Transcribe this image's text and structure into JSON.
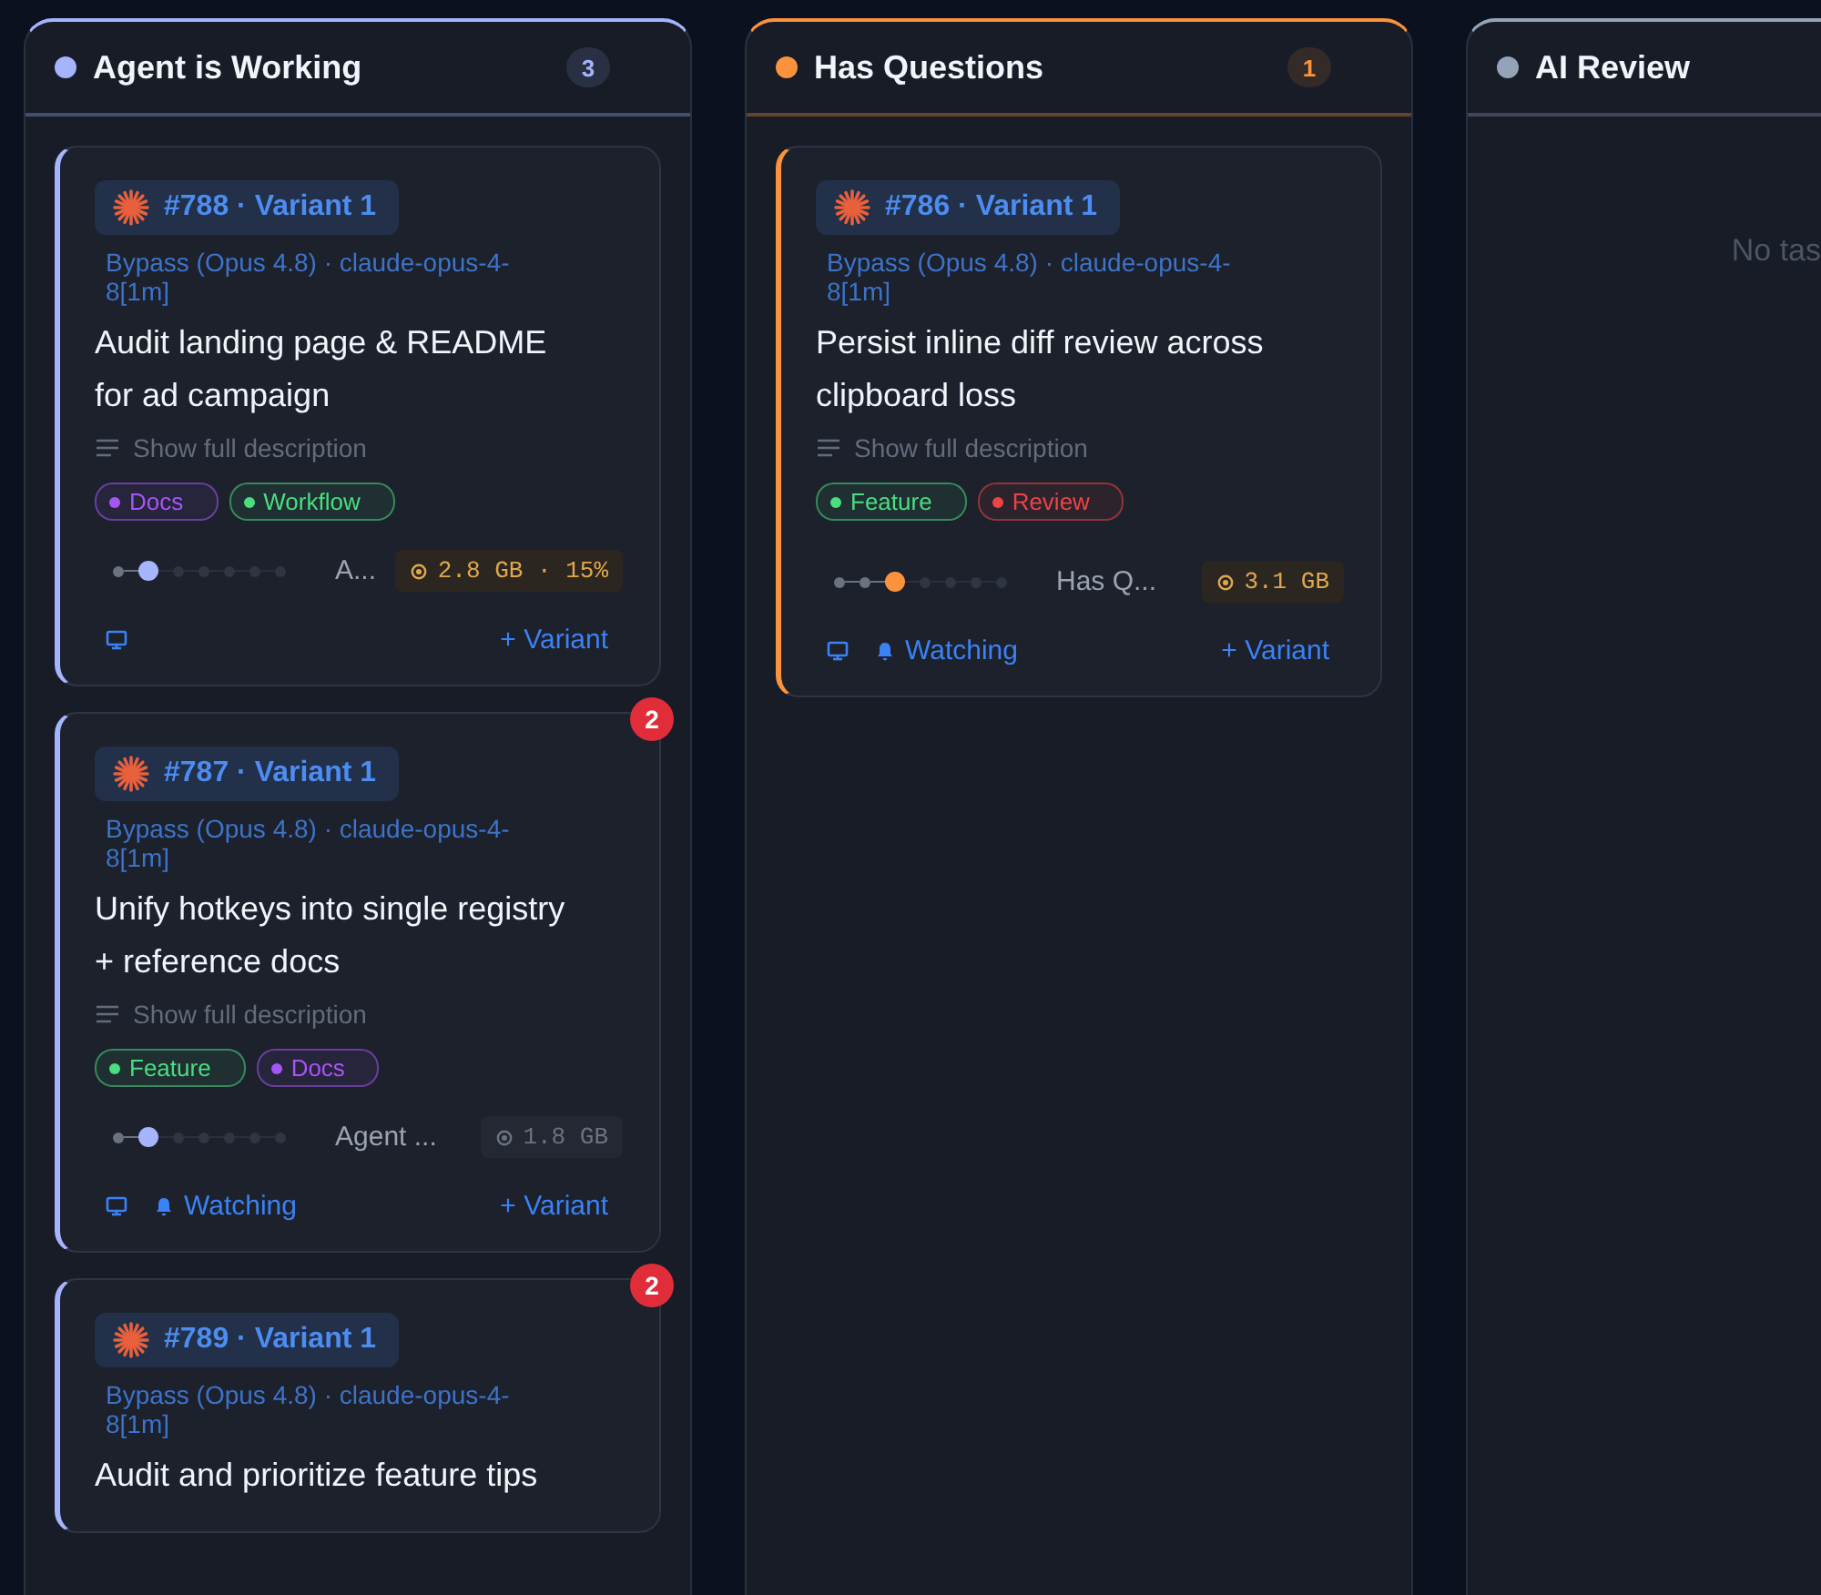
{
  "columns": [
    {
      "title": "Agent is Working",
      "color": "#a5b4fc",
      "count": "3",
      "cards": [
        {
          "ref": "#788 · Variant 1",
          "model": "Bypass (Opus 4.8) · claude-opus-4-8[1m]",
          "title": "Audit landing page & README for ad campaign",
          "toggle": "Show full description",
          "tags": [
            {
              "label": "Docs",
              "color": "#a855f7"
            },
            {
              "label": "Workflow",
              "color": "#4ade80"
            }
          ],
          "steps": [
            {
              "kind": "done"
            },
            {
              "kind": "current"
            },
            {
              "kind": "todo"
            },
            {
              "kind": "todo"
            },
            {
              "kind": "todo"
            },
            {
              "kind": "todo"
            },
            {
              "kind": "todo"
            }
          ],
          "status": "A...",
          "resource": {
            "text": "2.8 GB · 15%",
            "highlighted": true
          },
          "variant_label": "+ Variant"
        },
        {
          "ref": "#787 · Variant 1",
          "model": "Bypass (Opus 4.8) · claude-opus-4-8[1m]",
          "title": "Unify hotkeys into single registry + reference docs",
          "toggle": "Show full description",
          "tags": [
            {
              "label": "Feature",
              "color": "#4ade80"
            },
            {
              "label": "Docs",
              "color": "#a855f7"
            }
          ],
          "steps": [
            {
              "kind": "done"
            },
            {
              "kind": "current"
            },
            {
              "kind": "todo"
            },
            {
              "kind": "todo"
            },
            {
              "kind": "todo"
            },
            {
              "kind": "todo"
            },
            {
              "kind": "todo"
            }
          ],
          "status": "Agent ...",
          "resource": {
            "text": "1.8 GB",
            "highlighted": false
          },
          "watch_label": "Watching",
          "variant_label": "+ Variant",
          "badge": "2"
        },
        {
          "ref": "#789 · Variant 1",
          "model": "Bypass (Opus 4.8) · claude-opus-4-8[1m]",
          "title": "Audit and prioritize feature tips",
          "badge": "2"
        }
      ]
    },
    {
      "title": "Has Questions",
      "color": "#fb923c",
      "count": "1",
      "cards": [
        {
          "ref": "#786 · Variant 1",
          "model": "Bypass (Opus 4.8) · claude-opus-4-8[1m]",
          "title": "Persist inline diff review across clipboard loss",
          "toggle": "Show full description",
          "tags": [
            {
              "label": "Feature",
              "color": "#4ade80"
            },
            {
              "label": "Review",
              "color": "#ef4444"
            }
          ],
          "steps": [
            {
              "kind": "done"
            },
            {
              "kind": "done"
            },
            {
              "kind": "current"
            },
            {
              "kind": "todo"
            },
            {
              "kind": "todo"
            },
            {
              "kind": "todo"
            },
            {
              "kind": "todo"
            }
          ],
          "status": "Has Q...",
          "resource": {
            "text": "3.1 GB",
            "highlighted": true
          },
          "watch_label": "Watching",
          "variant_label": "+ Variant"
        }
      ]
    },
    {
      "title": "AI Review",
      "color": "#94a3b8",
      "empty_text": "No tas"
    }
  ]
}
